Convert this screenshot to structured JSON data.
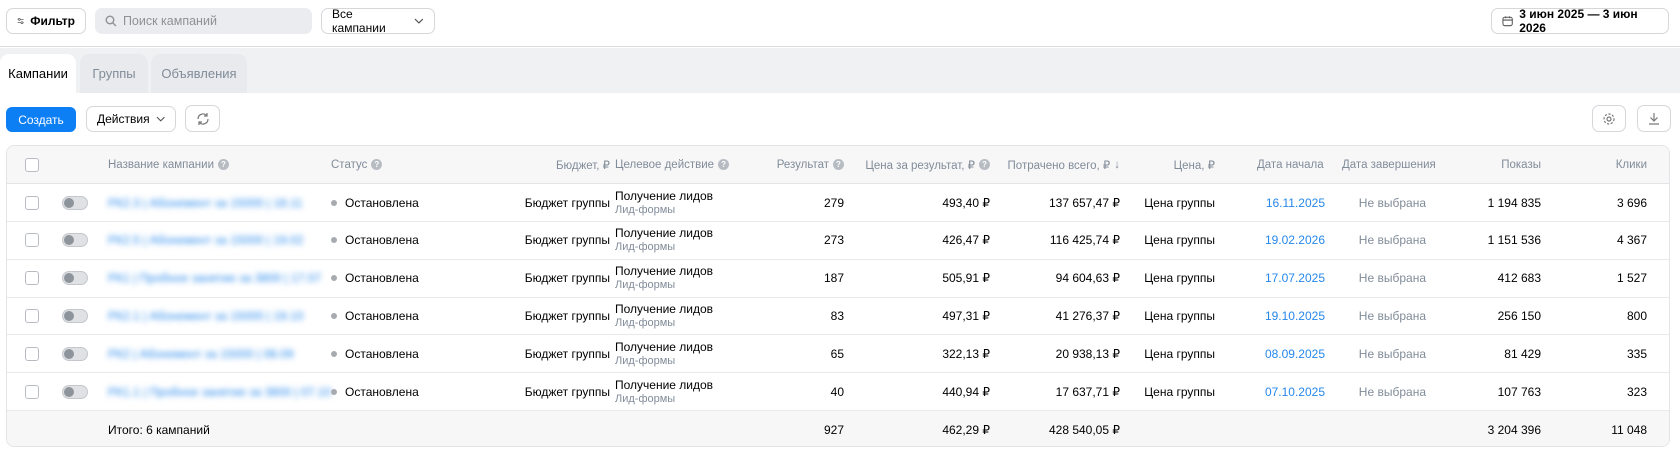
{
  "topbar": {
    "filter_label": "Фильтр",
    "search_placeholder": "Поиск кампаний",
    "campaign_select": "Все кампании",
    "date_range": "3 июн 2025 — 3 июн 2026"
  },
  "tabs": [
    {
      "label": "Кампании",
      "active": true
    },
    {
      "label": "Группы",
      "active": false
    },
    {
      "label": "Объявления",
      "active": false
    }
  ],
  "toolbar": {
    "create_label": "Создать",
    "actions_label": "Действия"
  },
  "colors": {
    "accent": "#0d7ff5",
    "link": "#2688eb",
    "muted_text": "#818c99"
  },
  "table": {
    "headers": {
      "name": "Название кампании",
      "status": "Статус",
      "budget": "Бюджет, ₽",
      "goal": "Целевое действие",
      "result": "Результат",
      "cost_per_result": "Цена за результат, ₽",
      "spent": "Потрачено всего, ₽",
      "price": "Цена, ₽",
      "start": "Дата начала",
      "end": "Дата завершения",
      "impressions": "Показы",
      "clicks": "Клики"
    },
    "rows": [
      {
        "name": "РК2.3 | Абонемент за 15000 | 18.11",
        "status": "Остановлена",
        "budget": "Бюджет группы",
        "goal": "Получение лидов",
        "goal_sub": "Лид-формы",
        "result": "279",
        "cost_per_result": "493,40 ₽",
        "spent": "137 657,47 ₽",
        "price": "Цена группы",
        "start": "16.11.2025",
        "end": "Не выбрана",
        "impressions": "1 194 835",
        "clicks": "3 696"
      },
      {
        "name": "РК2.5 | Абонемент за 15000 | 19.02",
        "status": "Остановлена",
        "budget": "Бюджет группы",
        "goal": "Получение лидов",
        "goal_sub": "Лид-формы",
        "result": "273",
        "cost_per_result": "426,47 ₽",
        "spent": "116 425,74 ₽",
        "price": "Цена группы",
        "start": "19.02.2026",
        "end": "Не выбрана",
        "impressions": "1 151 536",
        "clicks": "4 367"
      },
      {
        "name": "РК1 | Пробное занятие за 3800 | 17.07",
        "status": "Остановлена",
        "budget": "Бюджет группы",
        "goal": "Получение лидов",
        "goal_sub": "Лид-формы",
        "result": "187",
        "cost_per_result": "505,91 ₽",
        "spent": "94 604,63 ₽",
        "price": "Цена группы",
        "start": "17.07.2025",
        "end": "Не выбрана",
        "impressions": "412 683",
        "clicks": "1 527"
      },
      {
        "name": "РК2.1 | Абонемент за 15000 | 19.10",
        "status": "Остановлена",
        "budget": "Бюджет группы",
        "goal": "Получение лидов",
        "goal_sub": "Лид-формы",
        "result": "83",
        "cost_per_result": "497,31 ₽",
        "spent": "41 276,37 ₽",
        "price": "Цена группы",
        "start": "19.10.2025",
        "end": "Не выбрана",
        "impressions": "256 150",
        "clicks": "800"
      },
      {
        "name": "РК2 | Абонемент за 15000 | 08.09",
        "status": "Остановлена",
        "budget": "Бюджет группы",
        "goal": "Получение лидов",
        "goal_sub": "Лид-формы",
        "result": "65",
        "cost_per_result": "322,13 ₽",
        "spent": "20 938,13 ₽",
        "price": "Цена группы",
        "start": "08.09.2025",
        "end": "Не выбрана",
        "impressions": "81 429",
        "clicks": "335"
      },
      {
        "name": "РК1.1 | Пробное занятие за 3800 | 07.10",
        "status": "Остановлена",
        "budget": "Бюджет группы",
        "goal": "Получение лидов",
        "goal_sub": "Лид-формы",
        "result": "40",
        "cost_per_result": "440,94 ₽",
        "spent": "17 637,71 ₽",
        "price": "Цена группы",
        "start": "07.10.2025",
        "end": "Не выбрана",
        "impressions": "107 763",
        "clicks": "323"
      }
    ],
    "totals": {
      "label": "Итого: 6 кампаний",
      "result": "927",
      "cost_per_result": "462,29 ₽",
      "spent": "428 540,05 ₽",
      "impressions": "3 204 396",
      "clicks": "11 048"
    }
  }
}
